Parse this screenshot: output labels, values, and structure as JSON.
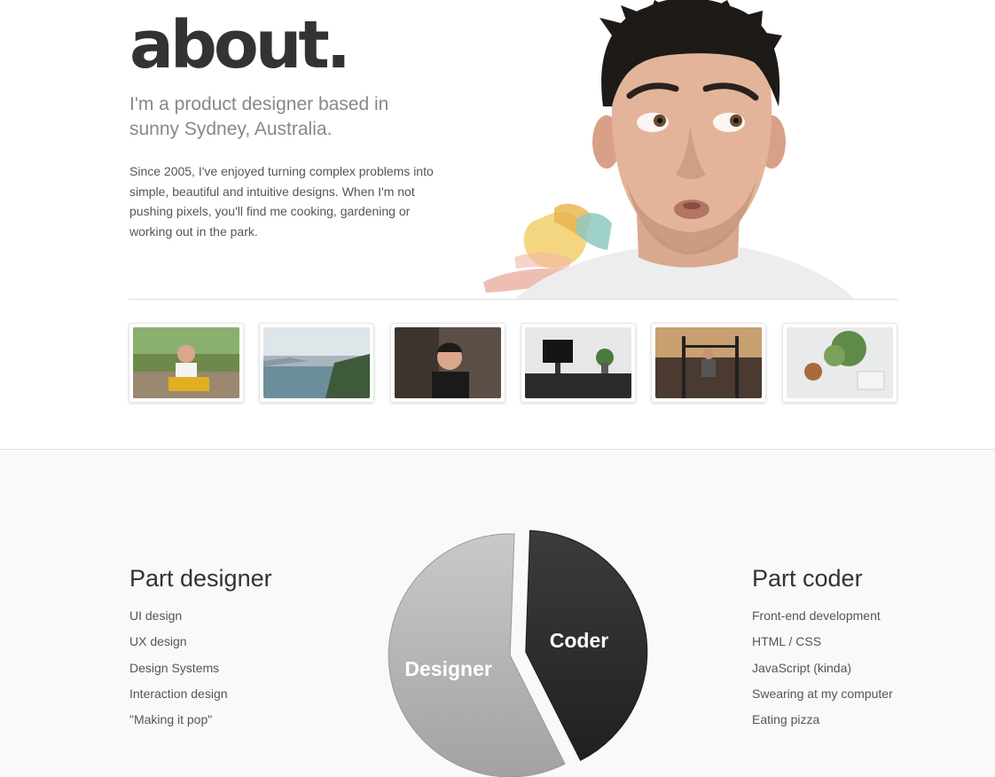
{
  "hero": {
    "title": "about.",
    "tagline": "I'm a product designer based in sunny Sydney, Australia.",
    "bio": "Since 2005, I've enjoyed turning complex problems into simple, beautiful and intuitive designs. When I'm not pushing pixels, you'll find me cooking, gardening or working out in the park."
  },
  "gallery": {
    "photos": [
      {
        "subject": "child-on-toy-photo"
      },
      {
        "subject": "harbour-view-photo"
      },
      {
        "subject": "selfie-photo"
      },
      {
        "subject": "desk-setup-photo"
      },
      {
        "subject": "park-workout-photo"
      },
      {
        "subject": "plant-and-lamp-photo"
      }
    ]
  },
  "skills": {
    "designer": {
      "title": "Part designer",
      "items": [
        "UI design",
        "UX design",
        "Design Systems",
        "Interaction design",
        "\"Making it pop\""
      ]
    },
    "coder": {
      "title": "Part coder",
      "items": [
        "Front-end development",
        "HTML / CSS",
        "JavaScript (kinda)",
        "Swearing at my computer",
        "Eating pizza"
      ]
    }
  },
  "chart_data": {
    "type": "pie",
    "categories": [
      "Designer",
      "Coder"
    ],
    "values": [
      58,
      42
    ],
    "colors": [
      "#b4b4b4",
      "#2f2f2f"
    ]
  }
}
